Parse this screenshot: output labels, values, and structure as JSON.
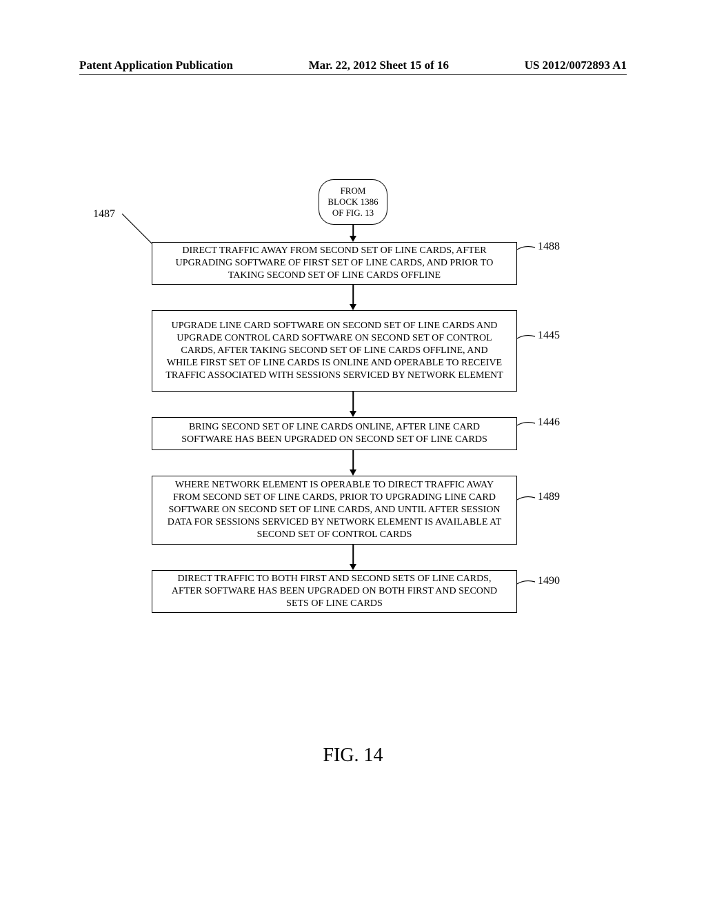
{
  "header": {
    "left": "Patent Application Publication",
    "center": "Mar. 22, 2012  Sheet 15 of 16",
    "right": "US 2012/0072893 A1"
  },
  "entry": {
    "line1": "FROM",
    "line2": "BLOCK 1386",
    "line3": "OF FIG. 13"
  },
  "refs": {
    "flow": "1487",
    "b1": "1488",
    "b2": "1445",
    "b3": "1446",
    "b4": "1489",
    "b5": "1490"
  },
  "boxes": {
    "b1": "DIRECT TRAFFIC AWAY FROM SECOND SET OF LINE CARDS, AFTER UPGRADING SOFTWARE OF FIRST SET OF LINE CARDS, AND PRIOR TO TAKING SECOND SET OF LINE CARDS OFFLINE",
    "b2": "UPGRADE LINE CARD SOFTWARE ON SECOND SET OF LINE CARDS AND UPGRADE CONTROL CARD SOFTWARE ON SECOND SET OF CONTROL CARDS, AFTER TAKING SECOND SET OF LINE CARDS OFFLINE, AND WHILE FIRST SET OF LINE CARDS IS ONLINE AND OPERABLE TO RECEIVE TRAFFIC ASSOCIATED WITH SESSIONS SERVICED BY NETWORK ELEMENT",
    "b3": "BRING SECOND SET OF LINE CARDS ONLINE, AFTER LINE CARD SOFTWARE HAS BEEN UPGRADED ON SECOND SET OF LINE CARDS",
    "b4": "WHERE NETWORK ELEMENT IS OPERABLE TO DIRECT TRAFFIC AWAY FROM SECOND SET OF LINE CARDS, PRIOR TO UPGRADING LINE CARD SOFTWARE ON SECOND SET OF LINE CARDS, AND UNTIL AFTER SESSION DATA FOR SESSIONS SERVICED BY NETWORK ELEMENT IS AVAILABLE AT SECOND SET OF CONTROL CARDS",
    "b5": "DIRECT TRAFFIC TO BOTH FIRST AND SECOND SETS OF LINE CARDS, AFTER SOFTWARE HAS BEEN UPGRADED ON BOTH FIRST AND SECOND SETS OF LINE CARDS"
  },
  "figure_label": "FIG. 14"
}
